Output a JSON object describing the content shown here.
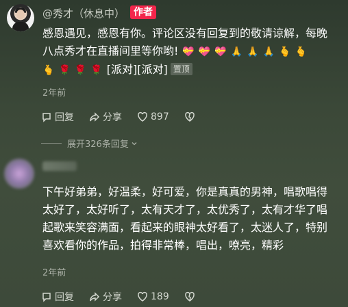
{
  "comment1": {
    "username": "@秀才（休息中）",
    "author_tag": "作者",
    "text_line1": "感恩遇见，感恩有你。评论区没有回复到的敬请谅解，每晚",
    "text_line2": "八点秀才在直播间里等你哟!",
    "emojis_line2": [
      "💝",
      "💝",
      "💝",
      "🙏",
      "🙏",
      "🙏",
      "🫰",
      "🫰"
    ],
    "emojis_line3": [
      "🫰",
      "🌹",
      "🌹",
      "🌹"
    ],
    "inline_tags": "[派对][派对]",
    "pin_tag": "置顶",
    "time": "2年前",
    "reply_label": "回复",
    "share_label": "分享",
    "like_count": "897",
    "expand_label": "展开326条回复"
  },
  "comment2": {
    "text_lines": [
      "下午好弟弟，好温柔，好可爱，你是真真的男神，唱歌唱得",
      "太好了，太好听了，太有天才了，太优秀了，太有才华了唱",
      "起歌来笑容满面，看起来的眼神太好看了，太迷人了，特别",
      "喜欢看你的作品，拍得非常棒，唱出，嘹亮，精彩"
    ],
    "time": "2年前",
    "reply_label": "回复",
    "share_label": "分享",
    "like_count": "189"
  },
  "colors": {
    "author_tag_bg": "#f3264b",
    "background": "#3b4838",
    "secondary_text": "#aab0a6"
  },
  "icons": [
    "reply-icon",
    "share-icon",
    "heart-icon",
    "dislike-icon",
    "chevron-down-icon"
  ]
}
